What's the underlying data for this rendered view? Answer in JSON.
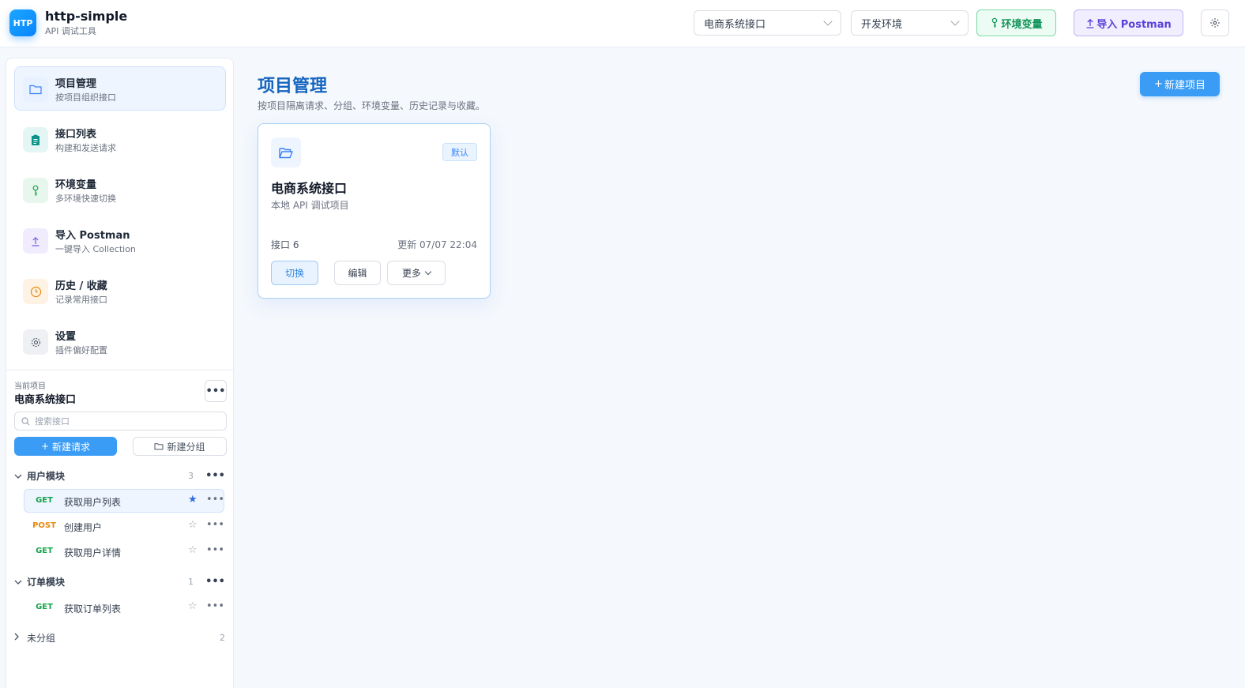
{
  "app": {
    "logo": "HTP",
    "title": "http-simple",
    "subtitle": "API 调试工具"
  },
  "header": {
    "project_select": "电商系统接口",
    "env_select": "开发环境",
    "env_button": "环境变量",
    "postman_button": "导入 Postman",
    "icons": {
      "env": "key-icon",
      "import": "upload-icon",
      "settings": "gear-icon"
    }
  },
  "sidebar": {
    "nav": [
      {
        "title": "项目管理",
        "desc": "按项目组织接口",
        "icon": "folder-icon",
        "color": "#3b82f6",
        "bg": "#e8f1ff"
      },
      {
        "title": "接口列表",
        "desc": "构建和发送请求",
        "icon": "clipboard-icon",
        "color": "#0d9488",
        "bg": "#e3f6f4"
      },
      {
        "title": "环境变量",
        "desc": "多环境快速切换",
        "icon": "key-icon",
        "color": "#16a34a",
        "bg": "#e7f7ed"
      },
      {
        "title": "导入 Postman",
        "desc": "一键导入 Collection",
        "icon": "upload-icon",
        "color": "#7c5ce0",
        "bg": "#f0ecfd"
      },
      {
        "title": "历史 / 收藏",
        "desc": "记录常用接口",
        "icon": "clock-icon",
        "color": "#ea8a0b",
        "bg": "#fdf2e3"
      },
      {
        "title": "设置",
        "desc": "插件偏好配置",
        "icon": "gear-icon",
        "color": "#4b5563",
        "bg": "#eef0f3"
      }
    ],
    "current_label": "当前项目",
    "current_name": "电商系统接口",
    "search_placeholder": "搜索接口",
    "new_request": "新建请求",
    "new_group": "新建分组",
    "groups": [
      {
        "name": "用户模块",
        "count": "3",
        "expanded": true,
        "requests": [
          {
            "method": "GET",
            "name": "获取用户列表",
            "starred": true,
            "active": true
          },
          {
            "method": "POST",
            "name": "创建用户",
            "starred": false,
            "active": false
          },
          {
            "method": "GET",
            "name": "获取用户详情",
            "starred": false,
            "active": false
          }
        ]
      },
      {
        "name": "订单模块",
        "count": "1",
        "expanded": true,
        "requests": [
          {
            "method": "GET",
            "name": "获取订单列表",
            "starred": false,
            "active": false
          }
        ]
      },
      {
        "name": "未分组",
        "count": "2",
        "expanded": false,
        "requests": []
      }
    ]
  },
  "main": {
    "title": "项目管理",
    "subtitle": "按项目隔离请求、分组、环境变量、历史记录与收藏。",
    "new_project": "新建项目",
    "card": {
      "badge": "默认",
      "name": "电商系统接口",
      "desc": "本地 API 调试项目",
      "count": "接口 6",
      "updated": "更新 07/07 22:04",
      "switch": "切换",
      "edit": "编辑",
      "more": "更多"
    }
  },
  "colors": {
    "accent": "#3b9cf5",
    "title": "#1565c0",
    "get": "#16a34a",
    "post": "#ea8a0b",
    "star_on": "#2f6fe0"
  }
}
